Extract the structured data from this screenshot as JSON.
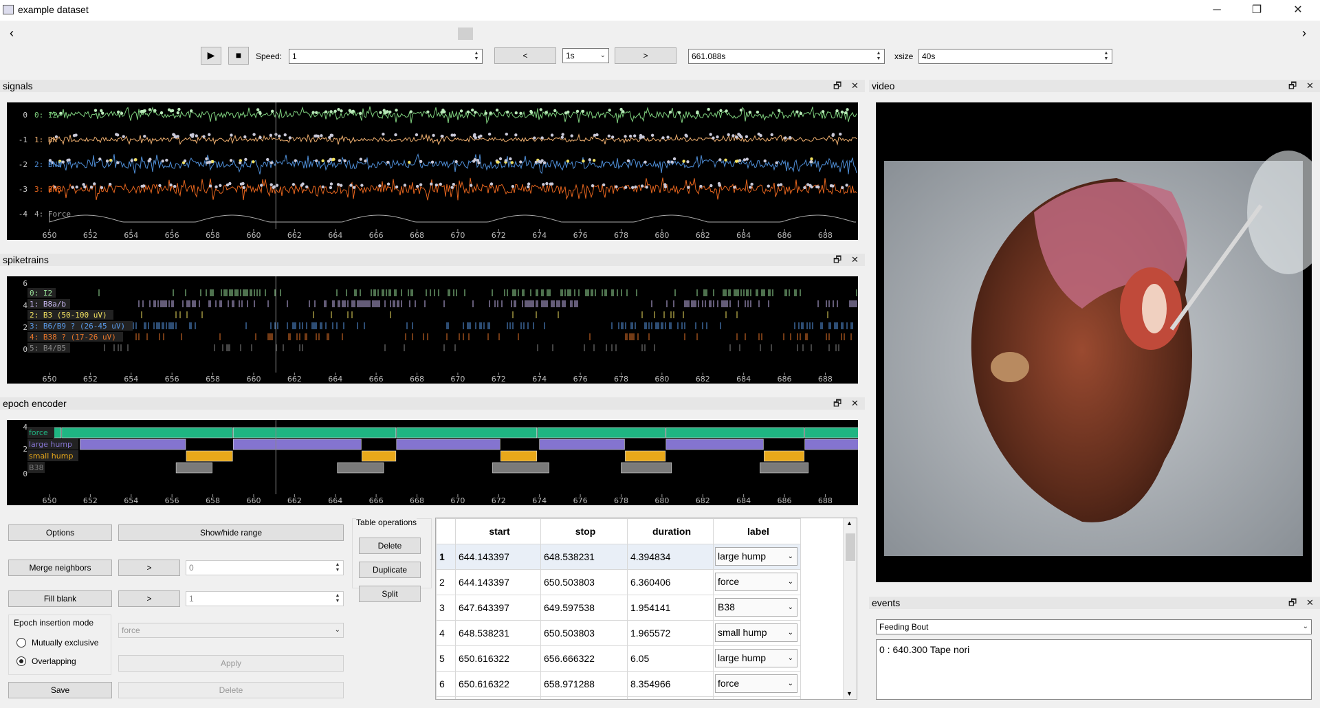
{
  "window": {
    "title": "example dataset",
    "minimize": "─",
    "maximize": "❐",
    "close": "✕"
  },
  "toolbar": {
    "scroll_left": "‹",
    "scroll_right": "›",
    "play": "▶",
    "stop": "■",
    "speed_label": "Speed:",
    "speed_value": "1",
    "prev": "<",
    "step_value": "1s",
    "next": ">",
    "time_value": "661.088s",
    "xsize_label": "xsize",
    "xsize_value": "40s"
  },
  "panels": {
    "signals": "signals",
    "spiketrains": "spiketrains",
    "epoch_encoder": "epoch encoder",
    "video": "video",
    "events": "events",
    "float_icon": "🗗",
    "close_icon": "✕"
  },
  "x_ticks": [
    "650",
    "652",
    "654",
    "656",
    "658",
    "660",
    "662",
    "664",
    "666",
    "668",
    "670",
    "672",
    "674",
    "676",
    "678",
    "680",
    "682",
    "684",
    "686",
    "688"
  ],
  "signals": {
    "y_ticks": [
      "0",
      "-1",
      "-2",
      "-3",
      "-4"
    ],
    "channels": [
      {
        "label": "0: I2",
        "color": "#7fd17f"
      },
      {
        "label": "1: RN",
        "color": "#f0b070"
      },
      {
        "label": "2: BN2",
        "color": "#4f8fd8"
      },
      {
        "label": "3: BN3",
        "color": "#e8661e"
      },
      {
        "label": "4: Force",
        "color": "#aaaaaa"
      }
    ]
  },
  "spiketrains": {
    "y_ticks": [
      "6",
      "4",
      "2",
      "0"
    ],
    "units": [
      {
        "label": "0: I2",
        "color": "#9be39b"
      },
      {
        "label": "1: B8a/b",
        "color": "#c8b8f0"
      },
      {
        "label": "2: B3 (50-100 uV)",
        "color": "#f0e060"
      },
      {
        "label": "3: B6/B9 ? (26-45 uV)",
        "color": "#5a9ae8"
      },
      {
        "label": "4: B38 ? (17-26 uV)",
        "color": "#e8762a"
      },
      {
        "label": "5: B4/B5",
        "color": "#888888"
      }
    ]
  },
  "epoch_encoder": {
    "y_ticks": [
      "4",
      "2",
      "0"
    ],
    "tracks": [
      {
        "label": "force",
        "color": "#1fb582"
      },
      {
        "label": "large hump",
        "color": "#8474d0"
      },
      {
        "label": "small hump",
        "color": "#e8a81a"
      },
      {
        "label": "B38",
        "color": "#7a7a7a"
      }
    ],
    "options": "Options",
    "show_hide_range": "Show/hide range",
    "merge_neighbors": "Merge neighbors",
    "merge_go": ">",
    "merge_value": "0",
    "fill_blank": "Fill blank",
    "fill_go": ">",
    "fill_value": "1",
    "insertion_mode_title": "Epoch insertion mode",
    "mode_exclusive": "Mutually exclusive",
    "mode_overlapping": "Overlapping",
    "label_select": "force",
    "apply": "Apply",
    "save": "Save",
    "delete_all": "Delete",
    "table_ops_title": "Table operations",
    "op_delete": "Delete",
    "op_duplicate": "Duplicate",
    "op_split": "Split",
    "table": {
      "headers": [
        "start",
        "stop",
        "duration",
        "label"
      ],
      "rows": [
        {
          "n": "1",
          "start": "644.143397",
          "stop": "648.538231",
          "duration": "4.394834",
          "label": "large hump"
        },
        {
          "n": "2",
          "start": "644.143397",
          "stop": "650.503803",
          "duration": "6.360406",
          "label": "force"
        },
        {
          "n": "3",
          "start": "647.643397",
          "stop": "649.597538",
          "duration": "1.954141",
          "label": "B38"
        },
        {
          "n": "4",
          "start": "648.538231",
          "stop": "650.503803",
          "duration": "1.965572",
          "label": "small hump"
        },
        {
          "n": "5",
          "start": "650.616322",
          "stop": "656.666322",
          "duration": "6.05",
          "label": "large hump"
        },
        {
          "n": "6",
          "start": "650.616322",
          "stop": "658.971288",
          "duration": "8.354966",
          "label": "force"
        }
      ]
    }
  },
  "events": {
    "selected": "Feeding Bout",
    "entries": [
      "0 : 640.300 Tape nori"
    ]
  }
}
